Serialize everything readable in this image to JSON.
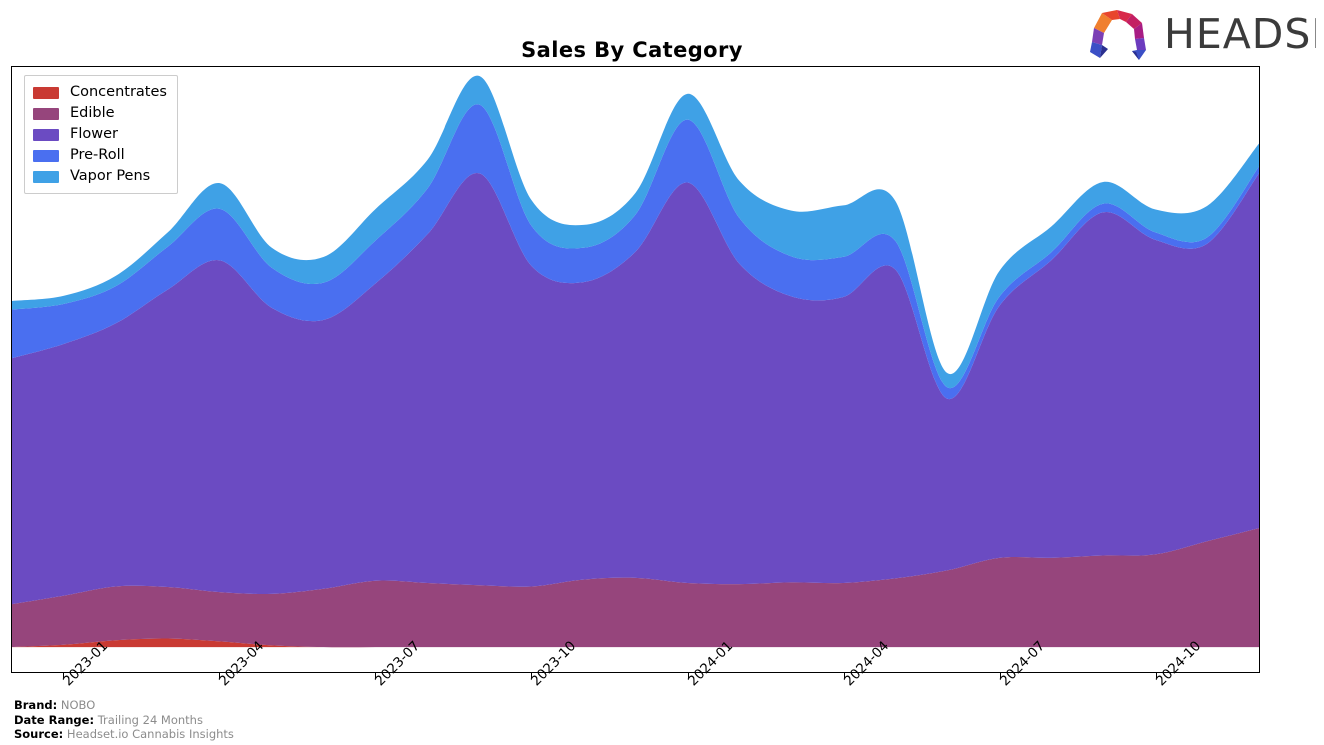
{
  "header": {
    "title": "Sales By Category",
    "logo_text": "HEADSET",
    "logo_name": "headset-logo"
  },
  "footer": {
    "brand_key": "Brand:",
    "brand_value": "NOBO",
    "date_range_key": "Date Range:",
    "date_range_value": "Trailing 24 Months",
    "source_key": "Source:",
    "source_value": "Headset.io Cannabis Insights"
  },
  "legend": {
    "position": "upper-left",
    "items": [
      {
        "label": "Concentrates",
        "color": "#C93A33"
      },
      {
        "label": "Edible",
        "color": "#96457C"
      },
      {
        "label": "Flower",
        "color": "#6B4BC2"
      },
      {
        "label": "Pre-Roll",
        "color": "#4A6FF0"
      },
      {
        "label": "Vapor Pens",
        "color": "#3FA1E6"
      }
    ]
  },
  "chart_data": {
    "type": "area",
    "stacked": true,
    "title": "Sales By Category",
    "xlabel": "",
    "ylabel": "",
    "grid": false,
    "legend_position": "upper left",
    "x": [
      "2022-12",
      "2023-01",
      "2023-02",
      "2023-03",
      "2023-04",
      "2023-05",
      "2023-06",
      "2023-07",
      "2023-08",
      "2023-09",
      "2023-10",
      "2023-11",
      "2023-12",
      "2024-01",
      "2024-02",
      "2024-03",
      "2024-04",
      "2024-05",
      "2024-06",
      "2024-07",
      "2024-08",
      "2024-09",
      "2024-10",
      "2024-11",
      "2024-12"
    ],
    "tick_labels": [
      "2023-01",
      "2023-04",
      "2023-07",
      "2023-10",
      "2024-01",
      "2024-04",
      "2024-07",
      "2024-10"
    ],
    "ylim": [
      0,
      100
    ],
    "series": [
      {
        "name": "Concentrates",
        "color": "#C93A33",
        "values": [
          0.0,
          0.4,
          1.2,
          1.5,
          1.0,
          0.3,
          0.0,
          0.0,
          0.0,
          0.0,
          0.0,
          0.0,
          0.0,
          0.0,
          0.0,
          0.0,
          0.0,
          0.0,
          0.0,
          0.0,
          0.0,
          0.0,
          0.0,
          0.0,
          0.0
        ]
      },
      {
        "name": "Edible",
        "color": "#96457C",
        "values": [
          7.5,
          8.6,
          9.4,
          9.0,
          8.6,
          9.0,
          10.2,
          11.6,
          11.2,
          10.8,
          10.6,
          11.8,
          12.1,
          11.2,
          11.0,
          11.3,
          11.2,
          12.0,
          13.4,
          15.6,
          15.6,
          16.0,
          16.2,
          18.5,
          20.8
        ]
      },
      {
        "name": "Flower",
        "color": "#6B4BC2",
        "values": [
          43.0,
          44.0,
          46.0,
          52.0,
          58.0,
          50.0,
          47.0,
          52.0,
          61.0,
          72.0,
          56.0,
          52.0,
          57.0,
          70.0,
          56.0,
          50.0,
          50.0,
          54.0,
          30.0,
          44.0,
          52.0,
          60.0,
          55.0,
          52.0,
          62.0
        ]
      },
      {
        "name": "Pre-Roll",
        "color": "#4A6FF0",
        "values": [
          8.5,
          7.0,
          6.5,
          7.5,
          9.0,
          7.0,
          6.5,
          7.5,
          8.0,
          12.0,
          7.0,
          6.0,
          6.5,
          11.0,
          8.0,
          7.0,
          7.0,
          5.0,
          2.0,
          1.6,
          1.4,
          1.5,
          1.3,
          1.1,
          1.2
        ]
      },
      {
        "name": "Vapor Pens",
        "color": "#3FA1E6",
        "values": [
          1.5,
          1.4,
          1.8,
          2.5,
          4.5,
          3.5,
          4.5,
          5.5,
          5.0,
          5.0,
          4.5,
          4.0,
          3.8,
          4.5,
          6.5,
          8.0,
          9.0,
          7.0,
          2.5,
          4.5,
          4.5,
          3.8,
          4.0,
          5.5,
          4.0
        ]
      }
    ]
  }
}
